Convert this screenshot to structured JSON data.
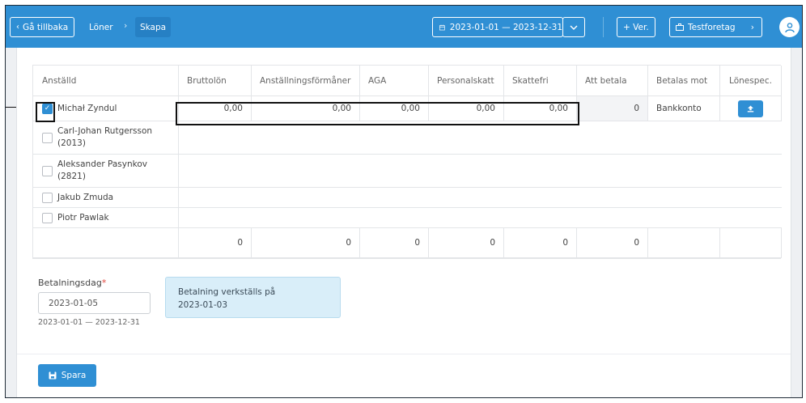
{
  "header": {
    "back_label": "Gå tillbaka",
    "breadcrumb": [
      "Löner",
      "Skapa"
    ],
    "date_range": "2023-01-01 — 2023-12-31",
    "ver_label": "+ Ver.",
    "company_label": "Testforetag"
  },
  "table": {
    "columns": [
      "Anställd",
      "Bruttolön",
      "Anställningsförmåner",
      "AGA",
      "Personalskatt",
      "Skattefri",
      "Att betala",
      "Betalas mot",
      "Lönespec."
    ],
    "employees": [
      {
        "name": "Michał Zyndul",
        "checked": true,
        "bruttolon": "0,00",
        "formaner": "0,00",
        "aga": "0,00",
        "personalskatt": "0,00",
        "skattefri": "0,00",
        "att_betala": "0",
        "betalas_mot": "Bankkonto"
      },
      {
        "name": "Carl-Johan Rutgersson (2013)",
        "line1": "Carl-Johan Rutgersson",
        "line2": "(2013)",
        "checked": false
      },
      {
        "name": "Aleksander Pasynkov (2821)",
        "line1": "Aleksander Pasynkov",
        "line2": "(2821)",
        "checked": false
      },
      {
        "name": "Jakub Zmuda",
        "checked": false
      },
      {
        "name": "Piotr Pawlak",
        "checked": false
      }
    ],
    "totals": [
      "0",
      "0",
      "0",
      "0",
      "0",
      "0"
    ]
  },
  "payment": {
    "label": "Betalningsdag",
    "required_mark": "*",
    "date_value": "2023-01-05",
    "range_hint": "2023-01-01 — 2023-12-31",
    "info_line1": "Betalning verkställs på",
    "info_line2": "2023-01-03"
  },
  "footer": {
    "save_label": "Spara"
  },
  "colors": {
    "primary": "#2f8fd4",
    "info_bg": "#d9eef9",
    "required": "#e0443b"
  }
}
